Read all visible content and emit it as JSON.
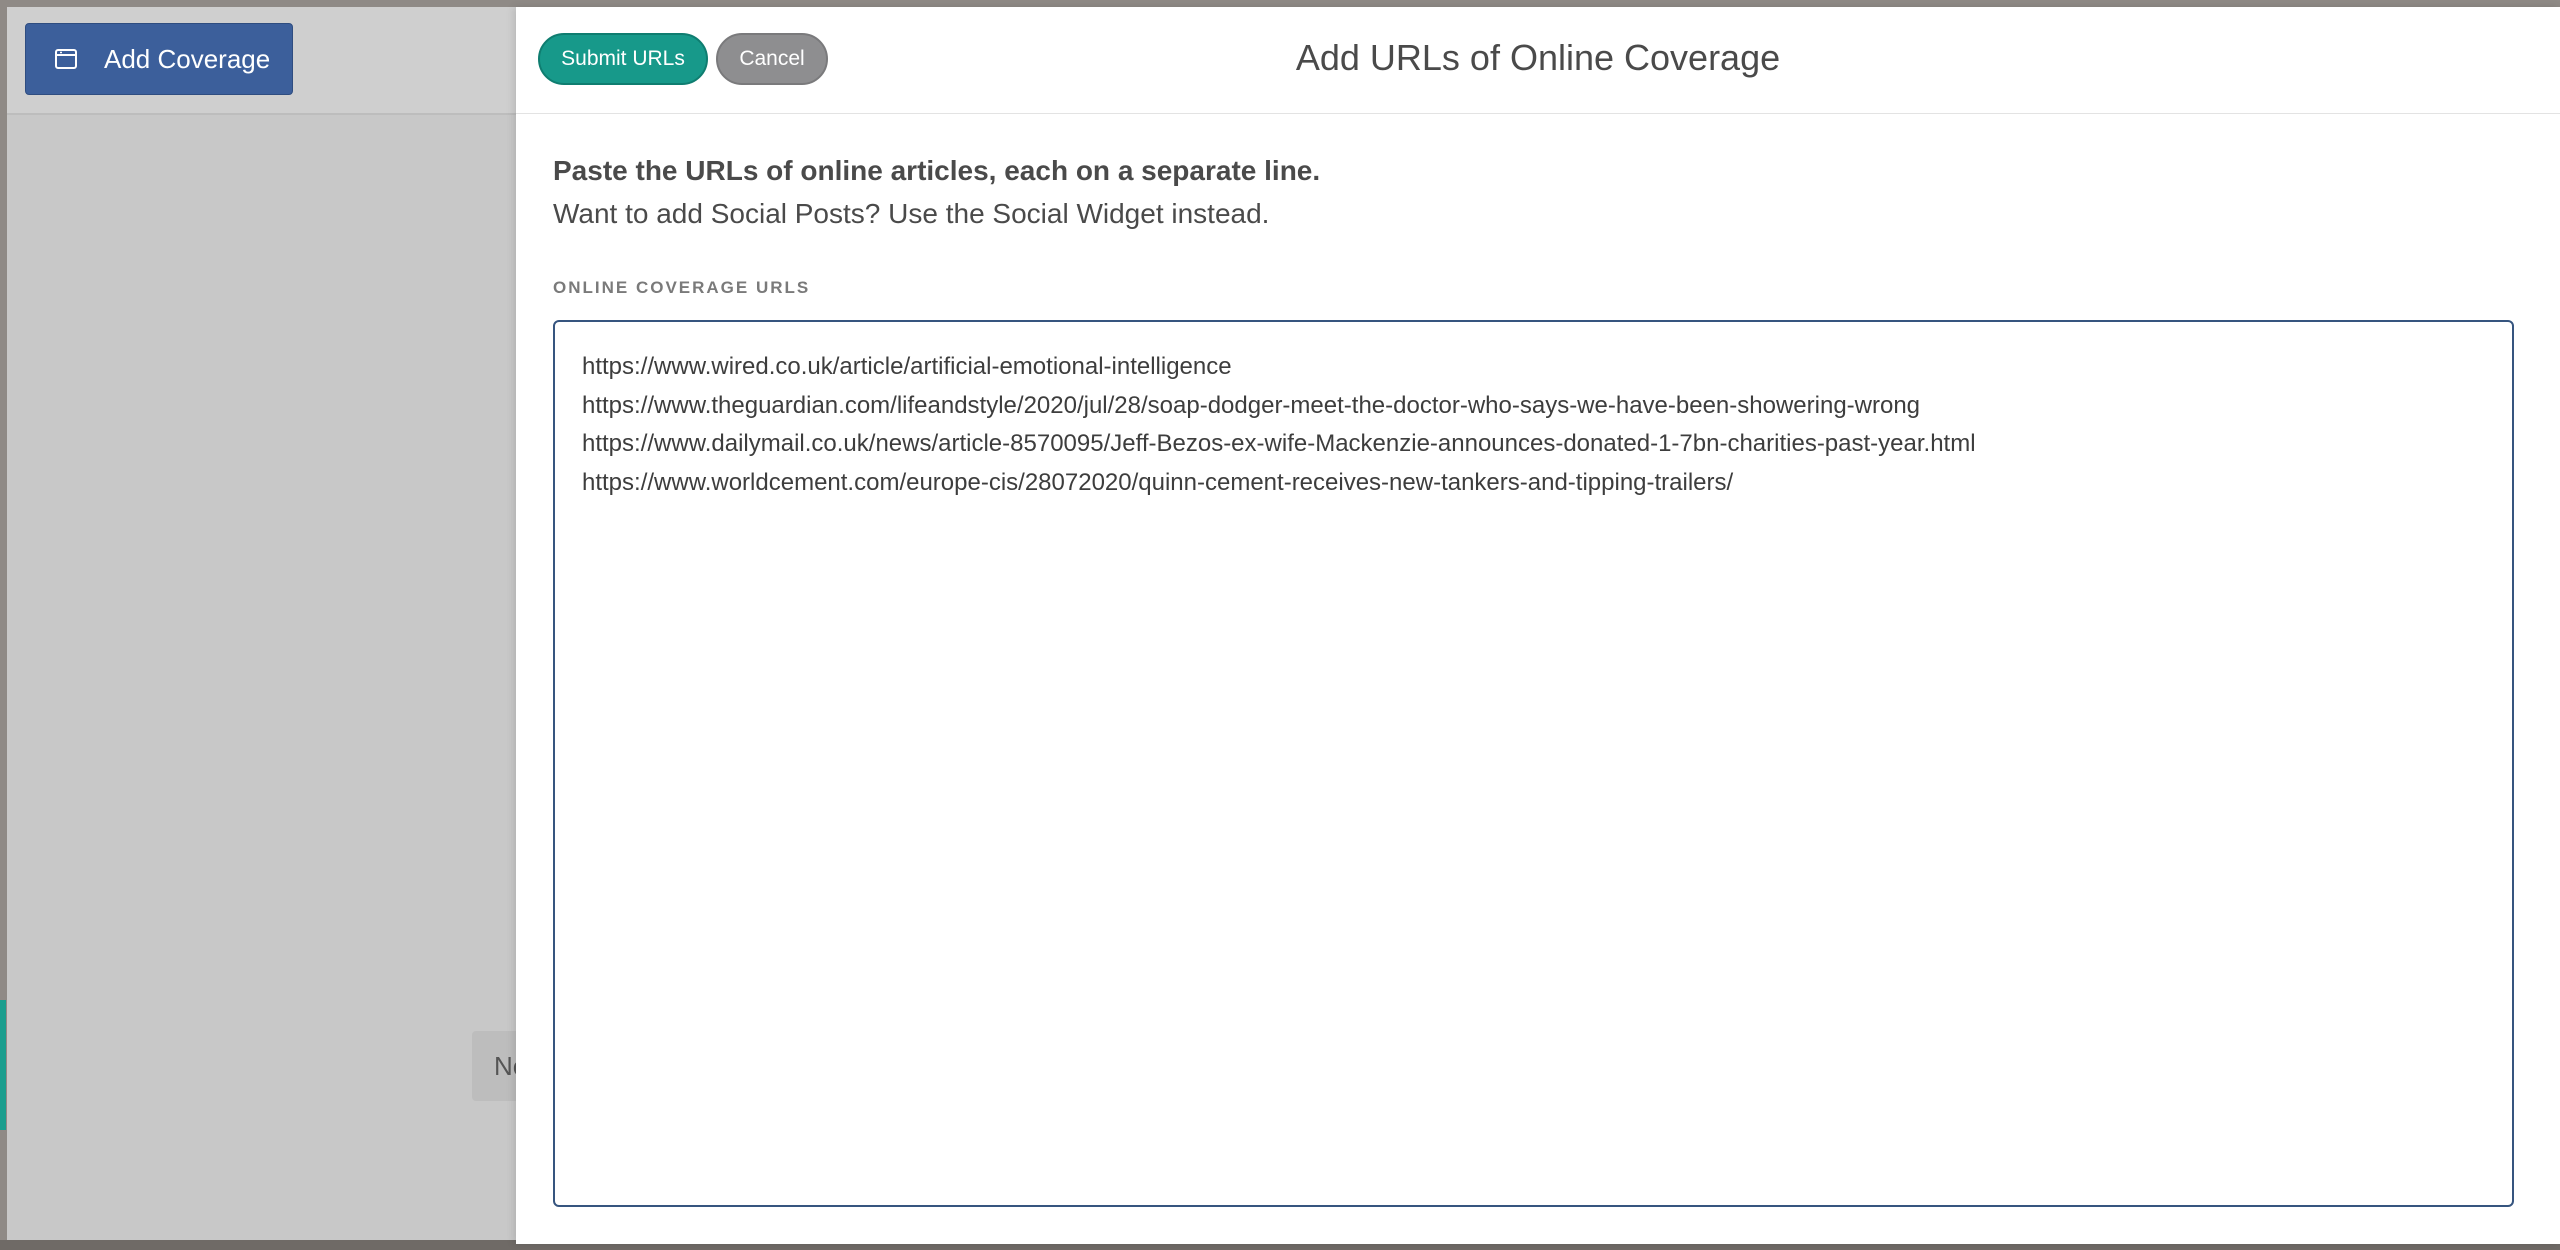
{
  "background": {
    "add_coverage_label": "Add Coverage",
    "ghost_chip_text": "Ne"
  },
  "modal": {
    "title": "Add URLs of Online Coverage",
    "submit_label": "Submit URLs",
    "cancel_label": "Cancel",
    "intro_bold": "Paste the URLs of online articles, each on a separate line.",
    "intro_normal": "Want to add Social Posts? Use the Social Widget instead.",
    "field_label": "ONLINE COVERAGE URLS",
    "urls": [
      "https://www.wired.co.uk/article/artificial-emotional-intelligence",
      "https://www.theguardian.com/lifeandstyle/2020/jul/28/soap-dodger-meet-the-doctor-who-says-we-have-been-showering-wrong",
      "https://www.dailymail.co.uk/news/article-8570095/Jeff-Bezos-ex-wife-Mackenzie-announces-donated-1-7bn-charities-past-year.html",
      "https://www.worldcement.com/europe-cis/28072020/quinn-cement-receives-new-tankers-and-tipping-trailers/"
    ]
  },
  "colors": {
    "submit": "#17998a",
    "cancel": "#8e8e90",
    "add_coverage": "#3c5f9b",
    "textarea_border": "#36557f"
  },
  "icons": {
    "add_coverage_icon": "calendar-window-icon"
  }
}
